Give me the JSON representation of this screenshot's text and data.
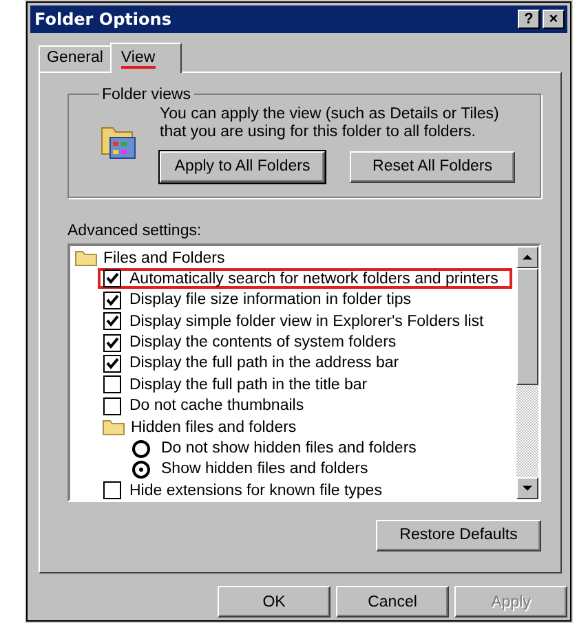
{
  "window": {
    "title": "Folder Options",
    "help_button": "?",
    "close_button": "×"
  },
  "tabs": [
    {
      "label": "General",
      "selected": false,
      "underlined": false
    },
    {
      "label": "View",
      "selected": true,
      "underlined": true
    }
  ],
  "folder_views": {
    "title": "Folder views",
    "description": "You can apply the view (such as Details or Tiles) that you are using for this folder to all folders.",
    "buttons": [
      "Apply to All Folders",
      "Reset All Folders"
    ]
  },
  "advanced_settings": {
    "label": "Advanced settings:",
    "items": [
      {
        "kind": "folder",
        "label": "Files and Folders",
        "children": [
          {
            "kind": "checkbox",
            "label": "Automatically search for network folders and printers",
            "checked": true,
            "highlighted": true
          },
          {
            "kind": "checkbox",
            "label": "Display file size information in folder tips",
            "checked": true,
            "highlighted": false
          },
          {
            "kind": "checkbox",
            "label": "Display simple folder view in Explorer's Folders list",
            "checked": true,
            "highlighted": false
          },
          {
            "kind": "checkbox",
            "label": "Display the contents of system folders",
            "checked": true,
            "highlighted": false
          },
          {
            "kind": "checkbox",
            "label": "Display the full path in the address bar",
            "checked": true,
            "highlighted": false
          },
          {
            "kind": "checkbox",
            "label": "Display the full path in the title bar",
            "checked": false,
            "highlighted": false
          },
          {
            "kind": "checkbox",
            "label": "Do not cache thumbnails",
            "checked": false,
            "highlighted": false
          },
          {
            "kind": "folder",
            "label": "Hidden files and folders",
            "children": [
              {
                "kind": "radio",
                "label": "Do not show hidden files and folders",
                "selected": false
              },
              {
                "kind": "radio",
                "label": "Show hidden files and folders",
                "selected": true
              }
            ]
          },
          {
            "kind": "checkbox",
            "label": "Hide extensions for known file types",
            "checked": false,
            "highlighted": false
          }
        ]
      }
    ],
    "restore_button": "Restore Defaults"
  },
  "buttons": [
    {
      "label": "OK",
      "disabled": false
    },
    {
      "label": "Cancel",
      "disabled": false
    },
    {
      "label": "Apply",
      "disabled": true
    }
  ]
}
